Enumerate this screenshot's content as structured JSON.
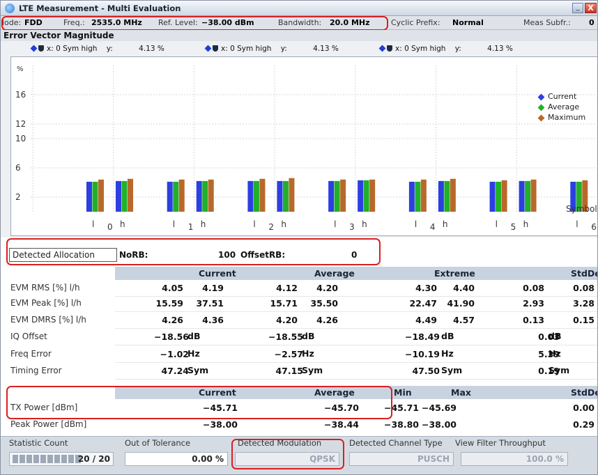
{
  "window": {
    "title": "LTE Measurement  - Multi Evaluation",
    "minimize": "_",
    "close": "X"
  },
  "info": {
    "mode_label": "lode:",
    "mode_value": "FDD",
    "freq_label": "Freq.:",
    "freq_value": "2535.0 MHz",
    "ref_label": "Ref. Level:",
    "ref_value": "−38.00 dBm",
    "bw_label": "Bandwidth:",
    "bw_value": "20.0 MHz",
    "cp_label": "Cyclic Prefix:",
    "cp_value": "Normal",
    "subfr_label": "Meas Subfr.:",
    "subfr_value": "0"
  },
  "evm": {
    "title": "Error Vector Magnitude",
    "markers": [
      {
        "x": "x: 0 Sym high",
        "y_label": "y:",
        "y_value": "4.13 %"
      },
      {
        "x": "x: 0 Sym high",
        "y_label": "y:",
        "y_value": "4.13 %"
      },
      {
        "x": "x: 0 Sym high",
        "y_label": "y:",
        "y_value": "4.13 %"
      }
    ]
  },
  "chart_data": {
    "type": "bar",
    "title": "",
    "ylabel": "%",
    "xlabel": "Symbol",
    "ylim": [
      0,
      20
    ],
    "y_ticks": [
      2,
      6,
      10,
      12,
      16
    ],
    "categories": [
      "0 l",
      "0 h",
      "1 l",
      "1 h",
      "2 l",
      "2 h",
      "3 l",
      "3 h",
      "4 l",
      "4 h",
      "5 l",
      "5 h",
      "6 l",
      "6 h"
    ],
    "x_tick_labels": [
      {
        "sym": "0",
        "l": "l",
        "h": "h"
      },
      {
        "sym": "1",
        "l": "l",
        "h": "h"
      },
      {
        "sym": "2",
        "l": "l",
        "h": "h"
      },
      {
        "sym": "3",
        "l": "l",
        "h": "h"
      },
      {
        "sym": "4",
        "l": "l",
        "h": "h"
      },
      {
        "sym": "5",
        "l": "l",
        "h": "h"
      },
      {
        "sym": "6",
        "l": "l",
        "h": "h"
      }
    ],
    "series": [
      {
        "name": "Current",
        "color": "#2c3fe0",
        "values": [
          4.1,
          4.2,
          4.1,
          4.2,
          4.2,
          4.2,
          4.2,
          4.3,
          4.1,
          4.2,
          4.1,
          4.2,
          4.1,
          4.2
        ]
      },
      {
        "name": "Average",
        "color": "#22b02a",
        "values": [
          4.1,
          4.2,
          4.1,
          4.2,
          4.2,
          4.2,
          4.2,
          4.3,
          4.1,
          4.2,
          4.1,
          4.2,
          4.1,
          4.2
        ]
      },
      {
        "name": "Maximum",
        "color": "#b8692a",
        "values": [
          4.4,
          4.5,
          4.4,
          4.4,
          4.5,
          4.6,
          4.4,
          4.4,
          4.4,
          4.5,
          4.3,
          4.4,
          4.3,
          4.5
        ]
      }
    ],
    "legend": "top-right",
    "grid": true
  },
  "alloc": {
    "label": "Detected Allocation",
    "norb_label": "NoRB:",
    "norb_value": "100",
    "offset_label": "OffsetRB:",
    "offset_value": "0"
  },
  "table1": {
    "headers": [
      "Current",
      "Average",
      "Extreme",
      "StdDev"
    ],
    "rows": [
      {
        "label": "EVM RMS [%] l/h",
        "vals": [
          "4.05",
          "4.19",
          "4.12",
          "4.20",
          "4.30",
          "4.40",
          "0.08",
          "0.08"
        ]
      },
      {
        "label": "EVM Peak [%] l/h",
        "vals": [
          "15.59",
          "37.51",
          "15.71",
          "35.50",
          "22.47",
          "41.90",
          "2.93",
          "3.28"
        ]
      },
      {
        "label": "EVM DMRS [%] l/h",
        "vals": [
          "4.26",
          "4.36",
          "4.20",
          "4.26",
          "4.49",
          "4.57",
          "0.13",
          "0.15"
        ]
      },
      {
        "label": "IQ Offset",
        "vals": [
          "−18.56",
          "dB",
          "−18.55",
          "dB",
          "−18.49",
          "dB",
          "0.03",
          "dB"
        ]
      },
      {
        "label": "Freq Error",
        "vals": [
          "−1.02",
          "Hz",
          "−2.57",
          "Hz",
          "−10.19",
          "Hz",
          "5.39",
          "Hz"
        ]
      },
      {
        "label": "Timing Error",
        "vals": [
          "47.24",
          "Sym",
          "47.15",
          "Sym",
          "47.50",
          "Sym",
          "0.19",
          "Sym"
        ]
      }
    ]
  },
  "table2": {
    "headers": [
      "Current",
      "Average",
      "Min",
      "Max",
      "StdDev"
    ],
    "rows": [
      {
        "label": "TX Power [dBm]",
        "vals": [
          "−45.71",
          "−45.70",
          "−45.71",
          "−45.69",
          "0.00"
        ]
      },
      {
        "label": "Peak Power [dBm]",
        "vals": [
          "−38.00",
          "−38.44",
          "−38.80",
          "−38.00",
          "0.29"
        ]
      }
    ]
  },
  "bottom": {
    "stat_label": "Statistic Count",
    "stat_value": "20 / 20",
    "oot_label": "Out of Tolerance",
    "oot_value": "0.00 %",
    "mod_label": "Detected Modulation",
    "mod_value": "QPSK",
    "chtype_label": "Detected Channel Type",
    "chtype_value": "PUSCH",
    "vf_label": "View Filter Throughput",
    "vf_value": "100.0 %"
  }
}
